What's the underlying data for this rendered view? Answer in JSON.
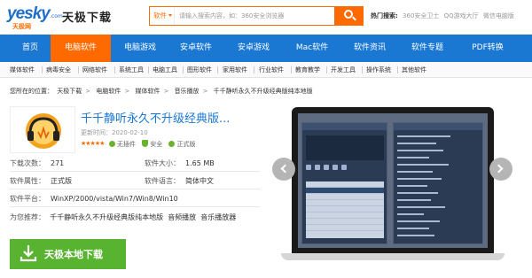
{
  "header": {
    "logo_text": "yesky",
    "logo_sub": "天极网",
    "logo_com": ".com",
    "site_name": "天极下载",
    "search": {
      "category": "软件",
      "placeholder": "请输入搜索内容，如：360安全浏览器"
    },
    "hot": {
      "label": "热门搜索:",
      "keywords": [
        "360安全卫士",
        "QQ游戏大厅",
        "微信电脑版"
      ]
    }
  },
  "nav": {
    "items": [
      {
        "label": "首页"
      },
      {
        "label": "电脑软件"
      },
      {
        "label": "电脑游戏"
      },
      {
        "label": "安卓软件"
      },
      {
        "label": "安卓游戏"
      },
      {
        "label": "Mac软件"
      },
      {
        "label": "软件资讯"
      },
      {
        "label": "软件专题"
      },
      {
        "label": "PDF转换"
      }
    ],
    "active_index": 1
  },
  "subnav": {
    "items": [
      "媒体软件",
      "病毒安全",
      "网络软件",
      "系统工具",
      "电脑工具",
      "图形软件",
      "家用软件",
      "行业软件",
      "教育教学",
      "开发工具",
      "操作系统",
      "其他软件"
    ]
  },
  "breadcrumb": {
    "label": "您所在的位置：",
    "items": [
      "天极下载",
      "电脑软件",
      "媒体软件",
      "音乐播放",
      "千千静听永久不升级经典版纯本地版"
    ]
  },
  "software": {
    "title": "千千静听永久不升级经典版...",
    "update_label": "更新时间：",
    "update_date": "2020-02-10",
    "stars": "★★★★★",
    "rating": 5,
    "badges": [
      "无插件",
      "安全",
      "正式版"
    ],
    "downloads_label": "下载次数：",
    "downloads": "271",
    "size_label": "软件大小：",
    "size": "1.65 MB",
    "attr_label": "软件属性：",
    "attr": "正式版",
    "lang_label": "软件语言：",
    "lang": "简体中文",
    "platform_label": "软件平台：",
    "platform": "WinXP/2000/vista/Win7/Win8/Win10",
    "recommend_label": "为您推荐：",
    "recommend": [
      "千千静听永久不升级经典版纯本地版",
      "音频播放",
      "音乐播放器"
    ],
    "download_button": "天极本地下载"
  },
  "colors": {
    "nav_blue": "#1a78d2",
    "accent_orange": "#ff6a00",
    "download_green": "#58b430"
  }
}
